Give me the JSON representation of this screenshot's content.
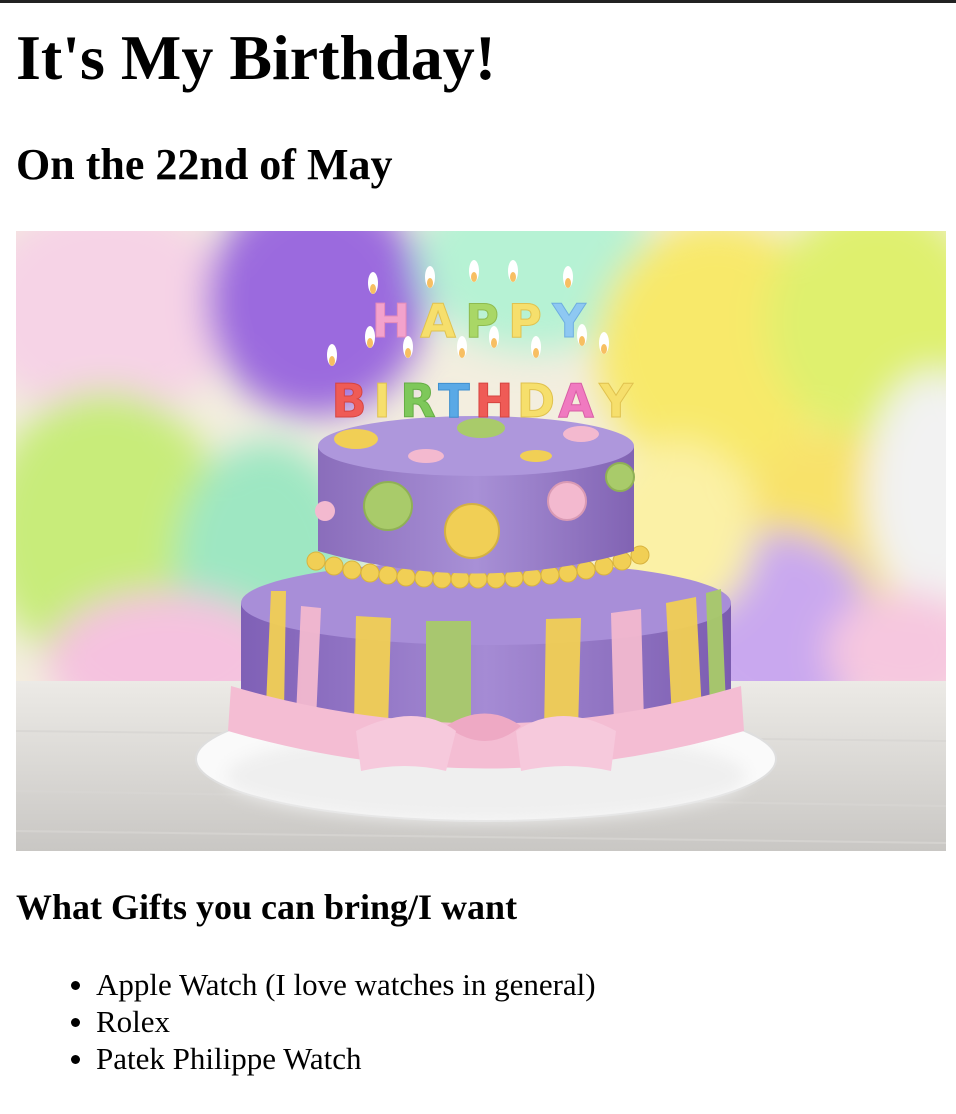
{
  "page": {
    "title": "It's My Birthday!",
    "date_heading": "On the 22nd of May",
    "gifts_heading": "What Gifts you can bring/I want"
  },
  "image": {
    "candle_letters_top": [
      "H",
      "A",
      "P",
      "P",
      "Y"
    ],
    "candle_letters_bottom": [
      "B",
      "I",
      "R",
      "T",
      "H",
      "D",
      "A",
      "Y"
    ],
    "colors": {
      "purple": "#9d83cc",
      "yellow": "#f1cf55",
      "green": "#a9cb6a",
      "pink": "#f3b9cf"
    }
  },
  "gifts": [
    "Apple Watch (I love watches in general)",
    "Rolex",
    "Patek Philippe Watch"
  ]
}
